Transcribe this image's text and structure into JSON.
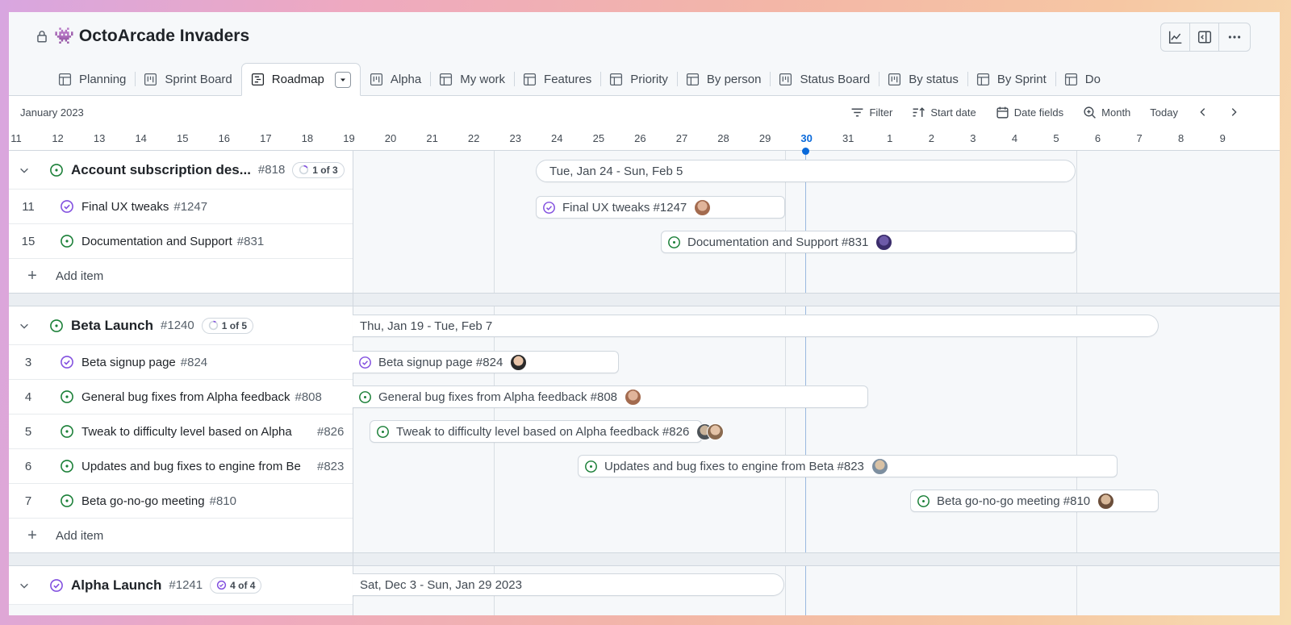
{
  "app": {
    "title": "OctoArcade Invaders",
    "emoji": "👾"
  },
  "tabs": [
    {
      "label": "Planning",
      "icon": "table-icon"
    },
    {
      "label": "Sprint Board",
      "icon": "board-icon"
    },
    {
      "label": "Roadmap",
      "icon": "roadmap-icon",
      "active": true
    },
    {
      "label": "Alpha",
      "icon": "board-icon"
    },
    {
      "label": "My work",
      "icon": "table-icon"
    },
    {
      "label": "Features",
      "icon": "table-icon"
    },
    {
      "label": "Priority",
      "icon": "table-icon"
    },
    {
      "label": "By person",
      "icon": "table-icon"
    },
    {
      "label": "Status Board",
      "icon": "board-icon"
    },
    {
      "label": "By status",
      "icon": "board-icon"
    },
    {
      "label": "By Sprint",
      "icon": "table-icon"
    },
    {
      "label": "Do",
      "icon": "table-icon"
    }
  ],
  "toolbar": {
    "month": "January 2023",
    "filter": "Filter",
    "start_date": "Start date",
    "date_fields": "Date fields",
    "zoom": "Month",
    "today": "Today"
  },
  "dates": [
    "11",
    "12",
    "13",
    "14",
    "15",
    "16",
    "17",
    "18",
    "19",
    "20",
    "21",
    "22",
    "23",
    "24",
    "25",
    "26",
    "27",
    "28",
    "29",
    "30",
    "31",
    "1",
    "2",
    "3",
    "4",
    "5",
    "6",
    "7",
    "8",
    "9"
  ],
  "today_date": "30",
  "groups": [
    {
      "title": "Account subscription des...",
      "number": "#818",
      "progress": "1 of 3",
      "range": "Tue, Jan 24 - Sun, Feb 5",
      "items": [
        {
          "num": "11",
          "title": "Final UX tweaks",
          "number": "#1247",
          "bar": "Final UX tweaks #1247",
          "status": "done"
        },
        {
          "num": "15",
          "title": "Documentation and Support",
          "number": "#831",
          "bar": "Documentation and Support #831",
          "status": "open"
        }
      ],
      "add": "Add item"
    },
    {
      "title": "Beta Launch",
      "number": "#1240",
      "progress": "1 of 5",
      "range": "Thu, Jan 19 - Tue, Feb 7",
      "items": [
        {
          "num": "3",
          "title": "Beta signup page",
          "number": "#824",
          "bar": "Beta signup page #824",
          "status": "done"
        },
        {
          "num": "4",
          "title": "General bug fixes from Alpha feedback",
          "number": "#808",
          "bar": "General bug fixes from Alpha feedback #808",
          "status": "open"
        },
        {
          "num": "5",
          "title": "Tweak to difficulty level based on Alpha",
          "number": "#826",
          "bar": "Tweak to difficulty level based on Alpha feedback #826",
          "status": "open"
        },
        {
          "num": "6",
          "title": "Updates and bug fixes to engine from Be",
          "number": "#823",
          "bar": "Updates and bug fixes to engine from Beta #823",
          "status": "open"
        },
        {
          "num": "7",
          "title": "Beta go-no-go meeting",
          "number": "#810",
          "bar": "Beta go-no-go meeting #810",
          "status": "open"
        }
      ],
      "add": "Add item"
    },
    {
      "title": "Alpha Launch",
      "number": "#1241",
      "progress": "4 of 4",
      "range": "Sat, Dec 3 - Sun, Jan 29 2023"
    }
  ],
  "colors": {
    "accent": "#0969da",
    "open": "#1a7f37",
    "done": "#8250df"
  }
}
